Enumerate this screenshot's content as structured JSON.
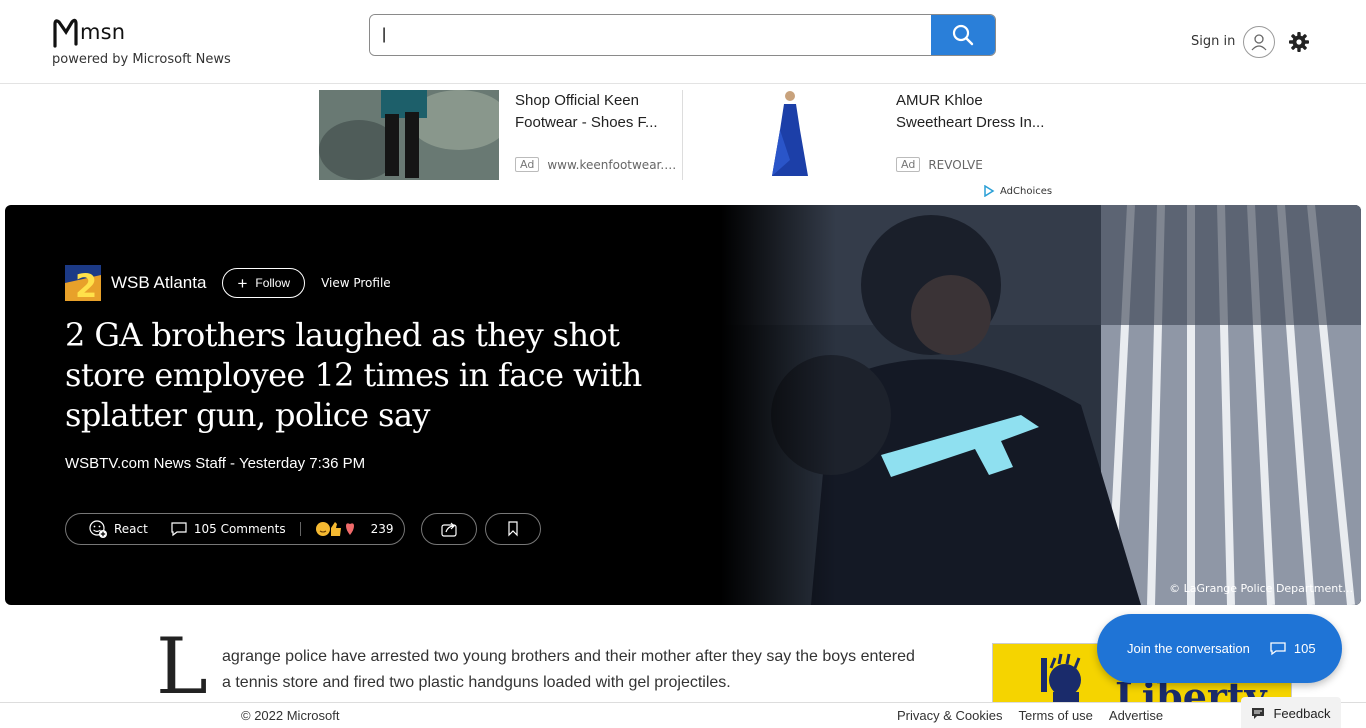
{
  "header": {
    "brand_name": "msn",
    "brand_sub": "powered by Microsoft News",
    "search_value": "|",
    "signin_label": "Sign in"
  },
  "ads": [
    {
      "title": "Shop Official Keen Footwear - Shoes F...",
      "tag": "Ad",
      "source": "www.keenfootwear.…"
    },
    {
      "title": "AMUR Khloe Sweetheart Dress In...",
      "tag": "Ad",
      "source": "REVOLVE"
    }
  ],
  "adchoices_label": "AdChoices",
  "article": {
    "publisher": "WSB Atlanta",
    "follow_label": "Follow",
    "view_profile_label": "View Profile",
    "headline": "2 GA brothers laughed as they shot store employee 12 times in face with splatter gun, police say",
    "byline": "WSBTV.com News Staff - Yesterday 7:36 PM",
    "react_label": "React",
    "comments_label": "105 Comments",
    "reactions_count": "239",
    "photo_credit": "© LaGrange Police Department...",
    "dropcap": "L",
    "body": "agrange police have arrested two young brothers and their mother after they say the boys entered a tennis store and fired two plastic handguns loaded with gel projectiles."
  },
  "side_ad_text": "Liberty",
  "join": {
    "label": "Join the conversation",
    "count": "105"
  },
  "footer": {
    "copyright": "© 2022 Microsoft",
    "links": [
      "Privacy & Cookies",
      "Terms of use",
      "Advertise"
    ],
    "feedback_label": "Feedback"
  },
  "colors": {
    "accent": "#2a7fd9",
    "join": "#1f74d6",
    "hero_bg": "#000000"
  }
}
